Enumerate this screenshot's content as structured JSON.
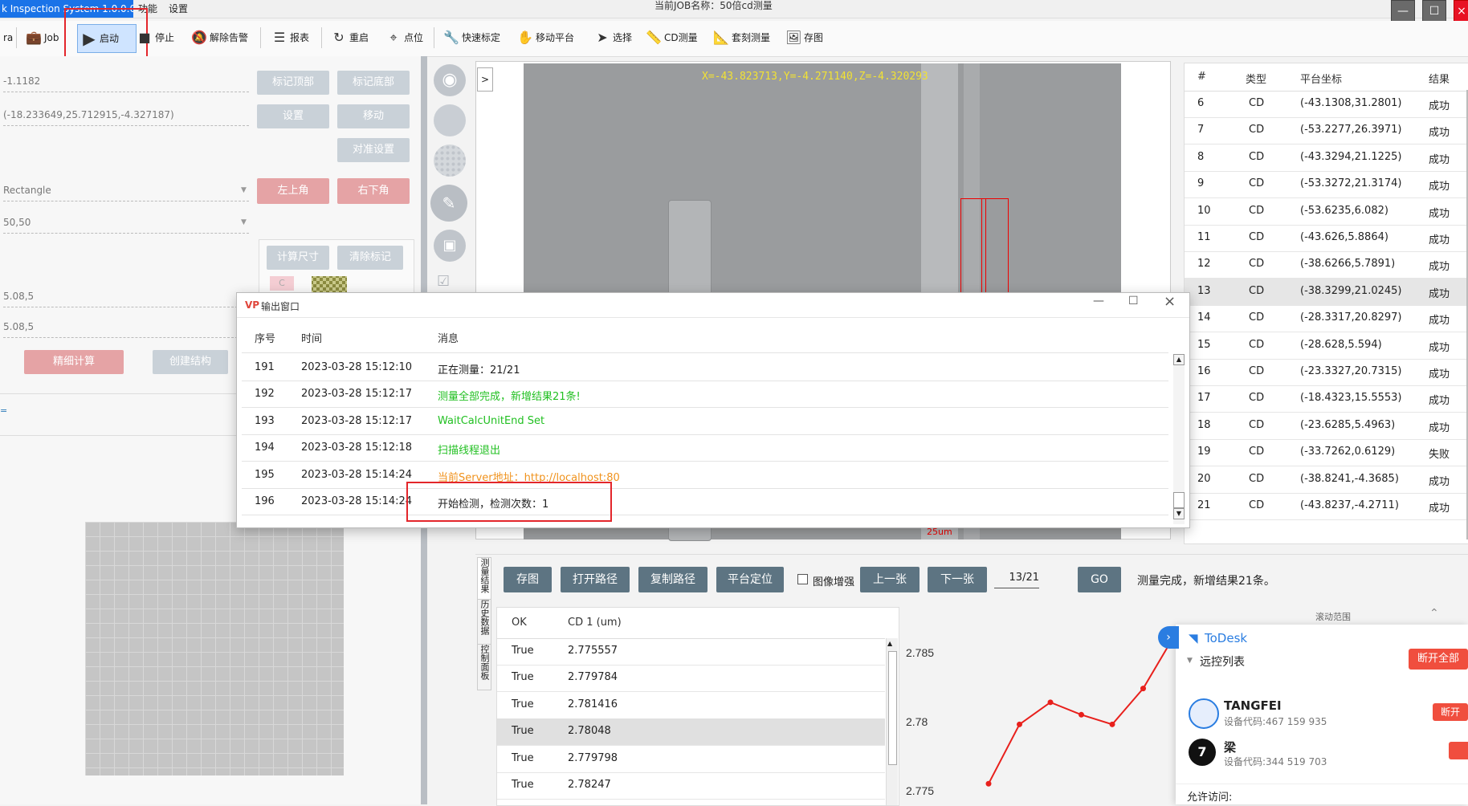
{
  "app": {
    "title": "k Inspection System 1.0.0.0",
    "menus": [
      "功能",
      "设置"
    ],
    "job_name": "当前JOB名称：50倍cd测量",
    "window_controls": [
      "minimize-icon",
      "maximize-icon",
      "close-icon"
    ]
  },
  "toolbar": {
    "items": [
      {
        "label": "ra",
        "icon": "camera-icon"
      },
      {
        "label": "Job",
        "icon": "briefcase-icon"
      },
      {
        "label": "启动",
        "icon": "play-icon"
      },
      {
        "label": "停止",
        "icon": "stop-icon"
      },
      {
        "label": "解除告警",
        "icon": "bell-off-icon"
      },
      {
        "label": "报表",
        "icon": "report-icon"
      },
      {
        "label": "重启",
        "icon": "refresh-icon"
      },
      {
        "label": "点位",
        "icon": "location-pin-icon"
      },
      {
        "label": "快速标定",
        "icon": "wrench-icon"
      },
      {
        "label": "移动平台",
        "icon": "hand-icon"
      },
      {
        "label": "选择",
        "icon": "cursor-icon"
      },
      {
        "label": "CD测量",
        "icon": "ruler-icon"
      },
      {
        "label": "套刻测量",
        "icon": "ruler-icon"
      },
      {
        "label": "存图",
        "icon": "image-icon"
      }
    ]
  },
  "left": {
    "field1": "-1.1182",
    "field2": "(-18.233649,25.712915,-4.327187)",
    "shape_select": "Rectangle",
    "size_select": "50,50",
    "field3": "5.08,5",
    "field4": "5.08,5",
    "btn_mark_top": "标记顶部",
    "btn_mark_bottom": "标记底部",
    "btn_settings": "设置",
    "btn_move": "移动",
    "btn_align": "对准设置",
    "btn_top_left": "左上角",
    "btn_bottom_right": "右下角",
    "btn_calc_size": "计算尺寸",
    "btn_clear_marks": "清除标记",
    "swatch_label": "C",
    "btn_fine_calc": "精细计算",
    "btn_create_struct": "创建结构",
    "tiny_label": "="
  },
  "viewer": {
    "coords": "X=-43.823713,Y=-4.271140,Z=-4.320293",
    "scale_label": "25um",
    "expander": ">",
    "tools": [
      "camera-icon",
      "grid-target-icon",
      "dot-grid-icon",
      "ruler-tool-icon",
      "image-edit-icon",
      "checklist-icon"
    ]
  },
  "output": {
    "title": "输出窗口",
    "headers": [
      "序号",
      "时间",
      "消息"
    ],
    "rows": [
      {
        "id": "191",
        "time": "2023-03-28 15:12:10",
        "msg": "正在测量：21/21",
        "color": "#222222"
      },
      {
        "id": "192",
        "time": "2023-03-28 15:12:17",
        "msg": "测量全部完成，新增结果21条!",
        "color": "#22c022"
      },
      {
        "id": "193",
        "time": "2023-03-28 15:12:17",
        "msg": "WaitCalcUnitEnd Set",
        "color": "#22c022"
      },
      {
        "id": "194",
        "time": "2023-03-28 15:12:18",
        "msg": "扫描线程退出",
        "color": "#22c022"
      },
      {
        "id": "195",
        "time": "2023-03-28 15:14:24",
        "msg": "当前Server地址：http://localhost:80",
        "color": "#f0921c"
      },
      {
        "id": "196",
        "time": "2023-03-28 15:14:24",
        "msg": "开始检测，检测次数：1",
        "color": "#222222"
      }
    ]
  },
  "results": {
    "headers": [
      "#",
      "类型",
      "平台坐标",
      "结果"
    ],
    "rows": [
      {
        "n": "6",
        "type": "CD",
        "coord": "(-43.1308,31.2801)",
        "result": "成功"
      },
      {
        "n": "7",
        "type": "CD",
        "coord": "(-53.2277,26.3971)",
        "result": "成功"
      },
      {
        "n": "8",
        "type": "CD",
        "coord": "(-43.3294,21.1225)",
        "result": "成功"
      },
      {
        "n": "9",
        "type": "CD",
        "coord": "(-53.3272,21.3174)",
        "result": "成功"
      },
      {
        "n": "10",
        "type": "CD",
        "coord": "(-53.6235,6.082)",
        "result": "成功"
      },
      {
        "n": "11",
        "type": "CD",
        "coord": "(-43.626,5.8864)",
        "result": "成功"
      },
      {
        "n": "12",
        "type": "CD",
        "coord": "(-38.6266,5.7891)",
        "result": "成功"
      },
      {
        "n": "13",
        "type": "CD",
        "coord": "(-38.3299,21.0245)",
        "result": "成功"
      },
      {
        "n": "14",
        "type": "CD",
        "coord": "(-28.3317,20.8297)",
        "result": "成功"
      },
      {
        "n": "15",
        "type": "CD",
        "coord": "(-28.628,5.594)",
        "result": "成功"
      },
      {
        "n": "16",
        "type": "CD",
        "coord": "(-23.3327,20.7315)",
        "result": "成功"
      },
      {
        "n": "17",
        "type": "CD",
        "coord": "(-18.4323,15.5553)",
        "result": "成功"
      },
      {
        "n": "18",
        "type": "CD",
        "coord": "(-23.6285,5.4963)",
        "result": "成功"
      },
      {
        "n": "19",
        "type": "CD",
        "coord": "(-33.7262,0.6129)",
        "result": "失败"
      },
      {
        "n": "20",
        "type": "CD",
        "coord": "(-38.8241,-4.3685)",
        "result": "成功"
      },
      {
        "n": "21",
        "type": "CD",
        "coord": "(-43.8237,-4.2711)",
        "result": "成功"
      }
    ]
  },
  "bottom": {
    "side_tabs": [
      "测量结果",
      "历史数据",
      "控制面板"
    ],
    "btn_save_image": "存图",
    "btn_open_path": "打开路径",
    "btn_copy_path": "复制路径",
    "btn_platform_locate": "平台定位",
    "enhance_label": "图像增强",
    "btn_prev": "上一张",
    "btn_next": "下一张",
    "page_indicator": "13/21",
    "btn_go": "GO",
    "status": "测量完成，新增结果21条。",
    "table_headers": [
      "OK",
      "CD 1 (um)"
    ],
    "table_rows": [
      {
        "ok": "True",
        "cd": "2.775557"
      },
      {
        "ok": "True",
        "cd": "2.779784"
      },
      {
        "ok": "True",
        "cd": "2.781416"
      },
      {
        "ok": "True",
        "cd": "2.78048"
      },
      {
        "ok": "True",
        "cd": "2.779798"
      },
      {
        "ok": "True",
        "cd": "2.78247"
      }
    ],
    "chart_partial_label": "滚动范围"
  },
  "chart_data": {
    "type": "line",
    "title": "",
    "xlabel": "",
    "ylabel": "",
    "yticks": [
      "2.785",
      "2.78",
      "2.775"
    ],
    "ylim": [
      2.774,
      2.7875
    ],
    "series": [
      {
        "values": [
          2.7755,
          2.7798,
          2.7814,
          2.7805,
          2.7798,
          2.7824,
          2.7862
        ],
        "color": "#e8201c"
      }
    ]
  },
  "todesk": {
    "brand": "ToDesk",
    "section": "远控列表",
    "btn_disconnect_all": "断开全部",
    "clients": [
      {
        "name": "TANGFEI",
        "code": "设备代码:467 159 935",
        "btn": "断开"
      },
      {
        "name": "梁",
        "code": "设备代码:344 519 703",
        "btn": ""
      }
    ],
    "allow_label": "允许访问:"
  }
}
